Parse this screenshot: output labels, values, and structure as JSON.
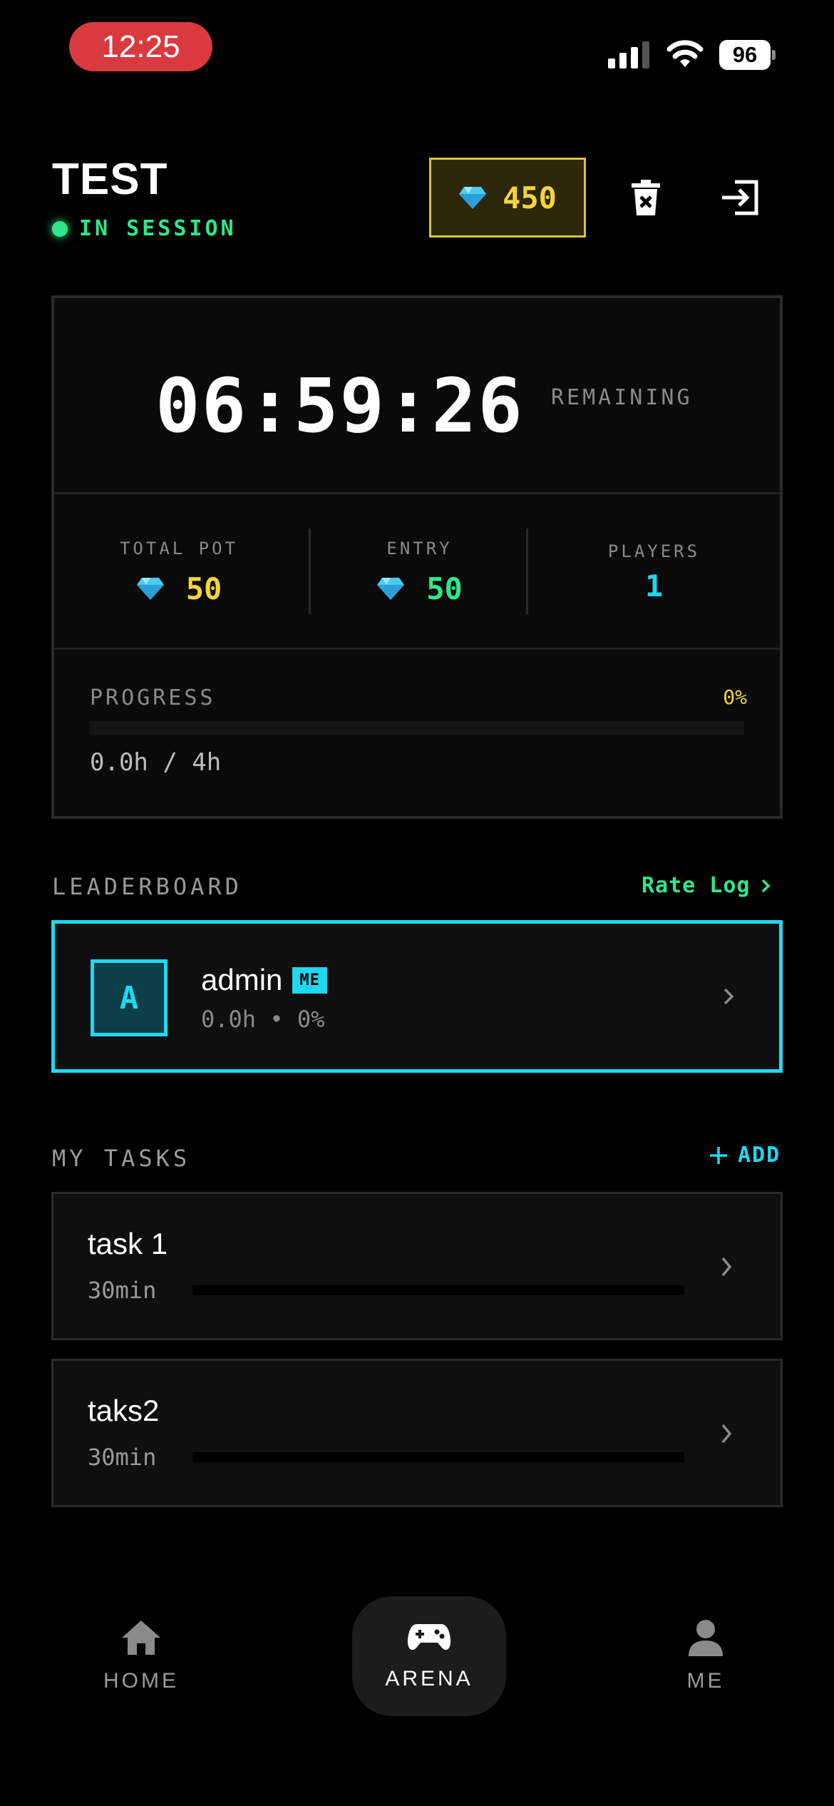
{
  "status_bar": {
    "time": "12:25",
    "battery": "96"
  },
  "header": {
    "title": "TEST",
    "status": "IN SESSION",
    "gems": "450"
  },
  "session": {
    "timer": "06:59:26",
    "timer_suffix": "REMAINING",
    "total_pot_label": "TOTAL POT",
    "total_pot_value": "50",
    "entry_label": "ENTRY",
    "entry_value": "50",
    "players_label": "PLAYERS",
    "players_value": "1",
    "progress_label": "PROGRESS",
    "progress_percent": "0%",
    "progress_value": 0,
    "progress_hours": "0.0h / 4h"
  },
  "leaderboard": {
    "title": "LEADERBOARD",
    "rate_log": "Rate Log",
    "rows": [
      {
        "initial": "A",
        "name": "admin",
        "badge": "ME",
        "stats": "0.0h • 0%"
      }
    ]
  },
  "tasks": {
    "title": "MY TASKS",
    "add_label": "ADD",
    "items": [
      {
        "name": "task 1",
        "duration": "30min",
        "progress": 0
      },
      {
        "name": "taks2",
        "duration": "30min",
        "progress": 0
      }
    ]
  },
  "tab_bar": {
    "items": [
      {
        "label": "HOME",
        "icon": "home-icon"
      },
      {
        "label": "ARENA",
        "icon": "gamepad-icon",
        "active": true
      },
      {
        "label": "ME",
        "icon": "person-icon"
      }
    ]
  },
  "colors": {
    "accent_cyan": "#1fd8f0",
    "accent_green": "#2ee889",
    "accent_gold": "#f2d43d",
    "status_red": "#d93a3f"
  }
}
